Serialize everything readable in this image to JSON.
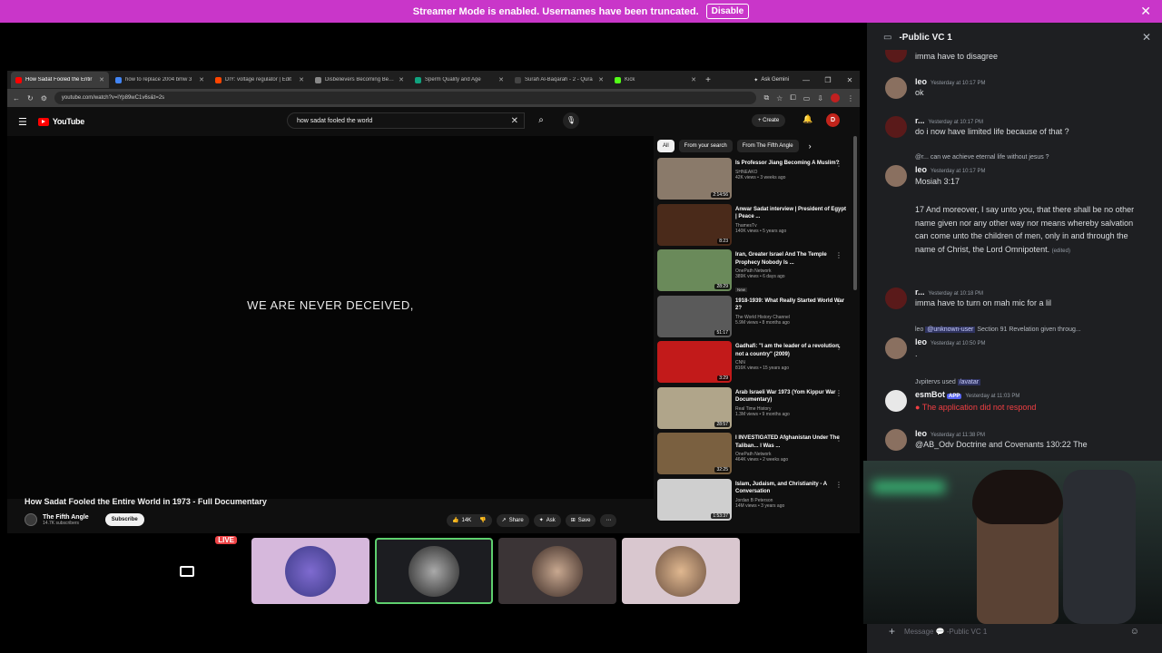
{
  "banner": {
    "text": "Streamer Mode is enabled. Usernames have been truncated.",
    "disable": "Disable"
  },
  "browser": {
    "tabs": [
      {
        "title": "How Sadat Fooled the Entir",
        "color": "#ff0000"
      },
      {
        "title": "how to replace 2004 bmw 3",
        "color": "#4285f4"
      },
      {
        "title": "DIY: voltage regulator | Edit",
        "color": "#ff4500"
      },
      {
        "title": "Disbelievers Becoming Believ",
        "color": "#888888"
      },
      {
        "title": "Sperm Quality and Age",
        "color": "#10a37f"
      },
      {
        "title": "Surah Al-Baqarah - 2 - Qura",
        "color": "#444444"
      },
      {
        "title": "Kick",
        "color": "#53fc18"
      }
    ],
    "gemini": "Ask Gemini",
    "url": "youtube.com/watch?v=lYp89wC1v6s&t=2s"
  },
  "youtube": {
    "logo": "YouTube",
    "search": "how sadat fooled the world",
    "create": "Create",
    "avatar": "D",
    "caption": "WE ARE NEVER DECEIVED,",
    "title": "How Sadat Fooled the Entire World in 1973 - Full Documentary",
    "channel": "The Fifth Angle",
    "subs": "14.7K subscribers",
    "subscribe": "Subscribe",
    "likes": "14K",
    "share": "Share",
    "ask": "Ask",
    "save": "Save",
    "chips": [
      "All",
      "From your search",
      "From The Fifth Angle"
    ],
    "recs": [
      {
        "title": "Is Professor Jiang Becoming A Muslim?",
        "channel": "SHNEAKO",
        "meta": "42K views • 3 weeks ago",
        "dur": "2:14:56",
        "thumb": "#8a7a6a",
        "badge": ""
      },
      {
        "title": "Anwar Sadat interview | President of Egypt | Peace ...",
        "channel": "ThamesTv",
        "meta": "140K views • 5 years ago",
        "dur": "8:23",
        "thumb": "#4a2a1a",
        "badge": ""
      },
      {
        "title": "Iran, Greater Israel And The Temple Prophecy Nobody Is ...",
        "channel": "OnePath Network",
        "meta": "389K views • 6 days ago",
        "dur": "28:29",
        "thumb": "#6a8a5a",
        "badge": "New"
      },
      {
        "title": "1918-1939: What Really Started World War 2?",
        "channel": "The World History Channel",
        "meta": "5.9M views • 8 months ago",
        "dur": "51:17",
        "thumb": "#5a5a5a",
        "badge": ""
      },
      {
        "title": "Gadhafi: \"I am the leader of a revolution, not a country\" (2009)",
        "channel": "CNN",
        "meta": "816K views • 15 years ago",
        "dur": "3:29",
        "thumb": "#c21a1a",
        "badge": ""
      },
      {
        "title": "Arab Israeli War 1973 (Yom Kippur War Documentary)",
        "channel": "Real Time History",
        "meta": "1.3M views • 9 months ago",
        "dur": "28:57",
        "thumb": "#b0a58a",
        "badge": ""
      },
      {
        "title": "I INVESTIGATED Afghanistan Under The Taliban... I Was ...",
        "channel": "OnePath Network",
        "meta": "464K views • 2 weeks ago",
        "dur": "32:25",
        "thumb": "#7a6040",
        "badge": ""
      },
      {
        "title": "Islam, Judaism, and Christianity - A Conversation",
        "channel": "Jordan B Peterson",
        "meta": "14M views • 3 years ago",
        "dur": "1:53:37",
        "thumb": "#cfcfcf",
        "badge": ""
      }
    ]
  },
  "tiles": {
    "live": "LIVE"
  },
  "discord": {
    "channel": "-Public VC 1",
    "placeholder": "Message 💬 -Public VC 1",
    "messages": {
      "m0": "imma have to disagree",
      "m1_name": "leo",
      "m1_ts": "Yesterday at 10:17 PM",
      "m1_text": "ok",
      "m2_name": "r...",
      "m2_ts": "Yesterday at 10:17 PM",
      "m2_text": "do i now have limited life because of that ?",
      "m3_reply": "@r... can we achieve eternal life without jesus ?",
      "m3_name": "leo",
      "m3_ts": "Yesterday at 10:17 PM",
      "m3_text": "Mosiah 3:17",
      "m3_body": "17 And moreover, I say unto you, that there shall be no other name given nor any other way nor means whereby salvation can come unto the children of men, only in and through the name of Christ, the Lord Omnipotent.",
      "m3_edited": "(edited)",
      "m4_name": "r...",
      "m4_ts": "Yesterday at 10:18 PM",
      "m4_text": "imma have to turn on mah mic for a lil",
      "m5_reply_user": "leo",
      "m5_reply_mention": "@unknown-user",
      "m5_reply_text": "Section 91 Revelation given throug...",
      "m5_name": "leo",
      "m5_ts": "Yesterday at 10:50 PM",
      "m5_text": ".",
      "m6_reply": "Jvpitervs used",
      "m6_cmd": "/avatar",
      "m6_name": "esmBot",
      "m6_badge": "APP",
      "m6_ts": "Yesterday at 11:03 PM",
      "m6_text": "The application did not respond",
      "m7_name": "leo",
      "m7_ts": "Yesterday at 11:38 PM",
      "m7_text": "@AB_Odv Doctrine and Covenants 130:22 The"
    }
  }
}
